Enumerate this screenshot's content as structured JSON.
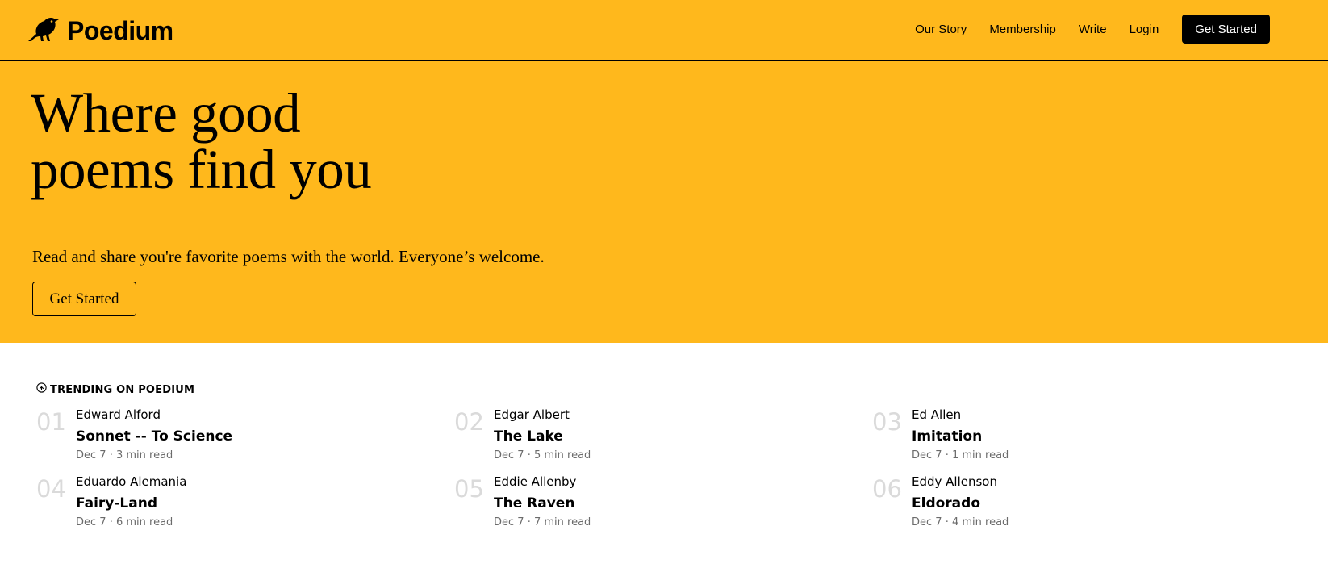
{
  "colors": {
    "brand_yellow": "#ffb81c",
    "text": "#000000",
    "muted": "#6b6b6b",
    "rank": "#dadada"
  },
  "header": {
    "logo_icon": "bird-icon",
    "brand": "Poedium",
    "nav": [
      "Our Story",
      "Membership",
      "Write",
      "Login"
    ],
    "cta": "Get Started"
  },
  "hero": {
    "title_line1": "Where good",
    "title_line2": "poems find you",
    "subtitle": "Read and share you're favorite poems with the world. Everyone’s welcome.",
    "cta": "Get Started"
  },
  "trending": {
    "icon": "trending-icon",
    "label": "TRENDING ON POEDIUM",
    "items": [
      {
        "rank": "01",
        "author": "Edward Alford",
        "title": "Sonnet -- To Science",
        "meta": "Dec 7 · 3 min read"
      },
      {
        "rank": "02",
        "author": "Edgar Albert",
        "title": "The Lake",
        "meta": "Dec 7 · 5 min read"
      },
      {
        "rank": "03",
        "author": "Ed Allen",
        "title": "Imitation",
        "meta": "Dec 7 · 1 min read"
      },
      {
        "rank": "04",
        "author": "Eduardo Alemania",
        "title": "Fairy-Land",
        "meta": "Dec 7 · 6 min read"
      },
      {
        "rank": "05",
        "author": "Eddie Allenby",
        "title": "The Raven",
        "meta": "Dec 7 · 7 min read"
      },
      {
        "rank": "06",
        "author": "Eddy Allenson",
        "title": "Eldorado",
        "meta": "Dec 7 · 4 min read"
      }
    ]
  }
}
